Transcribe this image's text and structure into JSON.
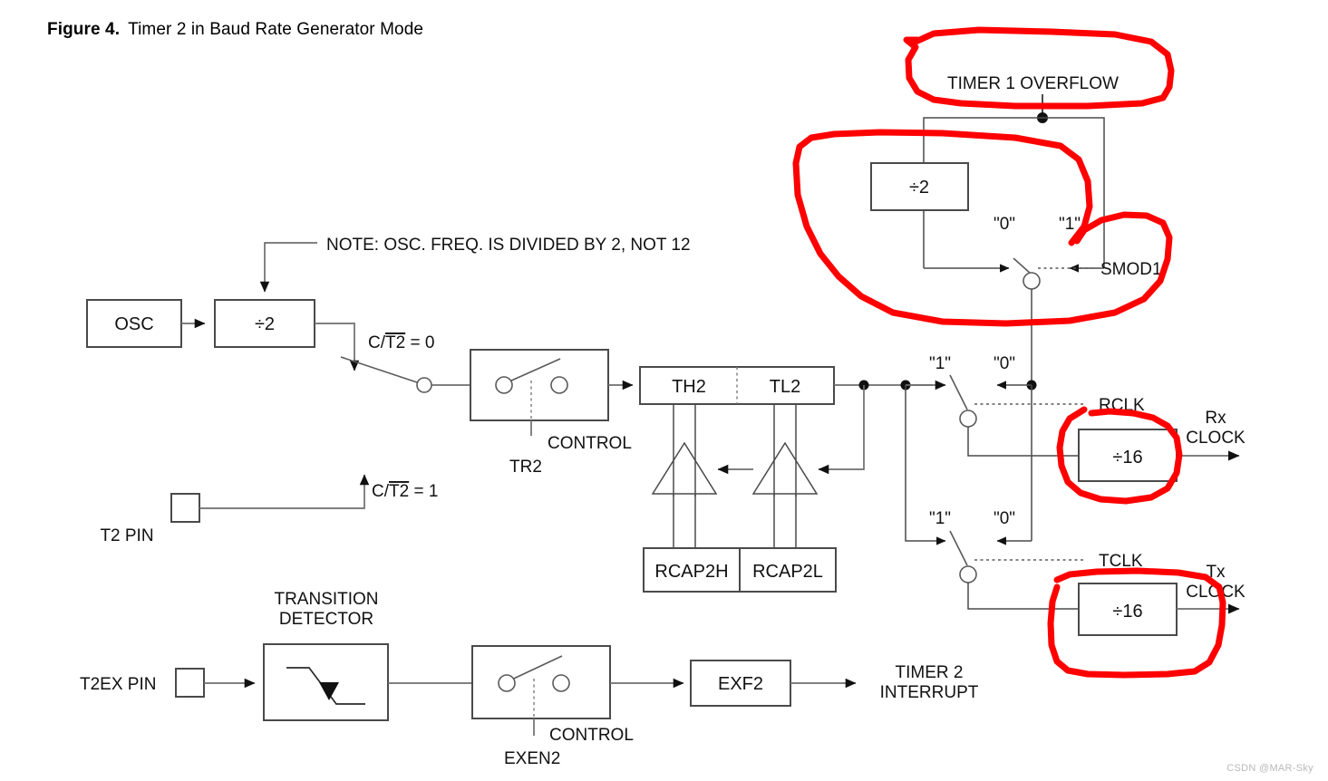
{
  "figure": {
    "label": "Figure 4.",
    "title": "Timer 2 in Baud Rate Generator Mode"
  },
  "watermark": "CSDN @MAR-Sky",
  "colors": {
    "annotation_red": "#ff0000",
    "wire": "#6e6e6e",
    "block_border": "#4a4a4a",
    "text": "#111111",
    "background": "#ffffff"
  },
  "blocks": {
    "osc": "OSC",
    "div2_osc": "÷2",
    "div2_smod": "÷2",
    "th2": "TH2",
    "tl2": "TL2",
    "rcap2h": "RCAP2H",
    "rcap2l": "RCAP2L",
    "div16_rx": "÷16",
    "div16_tx": "÷16",
    "exf2": "EXF2"
  },
  "labels": {
    "note": "NOTE: OSC. FREQ. IS DIVIDED BY 2, NOT 12",
    "timer1_overflow": "TIMER 1 OVERFLOW",
    "smod1": "SMOD1",
    "rclk": "RCLK",
    "tclk": "TCLK",
    "rx_clock_line1": "Rx",
    "rx_clock_line2": "CLOCK",
    "tx_clock_line1": "Tx",
    "tx_clock_line2": "CLOCK",
    "ct2_zero_prefix": "C/",
    "ct2_zero_bar": "T2",
    "ct2_zero_suffix": " = 0",
    "ct2_one_prefix": "C/",
    "ct2_one_bar": "T2",
    "ct2_one_suffix": " = 1",
    "t2_pin": "T2  PIN",
    "t2ex_pin": "T2EX  PIN",
    "transition_detector_line1": "TRANSITION",
    "transition_detector_line2": "DETECTOR",
    "control_tr2": "CONTROL",
    "tr2": "TR2",
    "control_exen2": "CONTROL",
    "exen2": "EXEN2",
    "timer2_interrupt_line1": "TIMER 2",
    "timer2_interrupt_line2": "INTERRUPT",
    "smod_zero": "\"0\"",
    "smod_one": "\"1\"",
    "rclk_one": "\"1\"",
    "rclk_zero": "\"0\"",
    "tclk_one": "\"1\"",
    "tclk_zero": "\"0\""
  },
  "annotations": {
    "count": 4,
    "items": [
      {
        "name": "timer1-overflow-circle",
        "target": "TIMER 1 OVERFLOW"
      },
      {
        "name": "smod1-divider-circle",
        "target": "÷2 and SMOD1 switch"
      },
      {
        "name": "rx-div16-circle",
        "target": "÷16 Rx clock divider"
      },
      {
        "name": "tx-div16-circle",
        "target": "÷16 Tx clock divider"
      }
    ]
  }
}
